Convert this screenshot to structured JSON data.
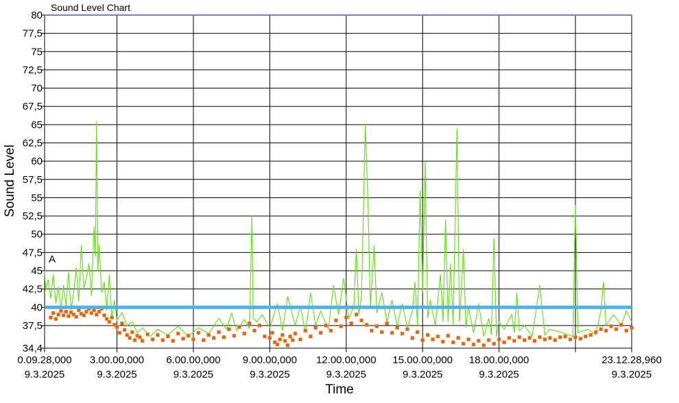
{
  "chart_data": {
    "type": "line",
    "title": "Sound Level Chart",
    "xlabel": "Time",
    "ylabel": "Sound Level",
    "ylim": [
      34.4,
      80
    ],
    "y_ticks": [
      "80",
      "77,5",
      "75",
      "72,5",
      "70",
      "67,5",
      "65",
      "62,5",
      "60",
      "57,5",
      "55",
      "52,5",
      "50",
      "47,5",
      "45",
      "42,5",
      "40",
      "37,5",
      "34,4"
    ],
    "x_range_hours": [
      0.158,
      23.208
    ],
    "x_ticks": [
      {
        "hour": 0.158,
        "time": "0.09.28,000",
        "date": "9.3.2025"
      },
      {
        "hour": 3,
        "time": "3.00.00,000",
        "date": "9.3.2025"
      },
      {
        "hour": 6,
        "time": "6.00.00,000",
        "date": "9.3.2025"
      },
      {
        "hour": 9,
        "time": "9.00.00,000",
        "date": "9.3.2025"
      },
      {
        "hour": 12,
        "time": "12.00.00,000",
        "date": "9.3.2025"
      },
      {
        "hour": 15,
        "time": "15.00.00,000",
        "date": "9.3.2025"
      },
      {
        "hour": 18,
        "time": "18.00.00,000",
        "date": "9.3.2025"
      },
      {
        "hour": 21,
        "time": "",
        "date": ""
      },
      {
        "hour": 23.208,
        "time": "23.12.28,960",
        "date": "9.3.2025"
      }
    ],
    "threshold": 40,
    "marker_label": "A",
    "colors": {
      "peak_line": "#66e01a",
      "level_markers": "#ee5a24",
      "level_marker_edge": "#c8b43c",
      "threshold": "#4fb3ea",
      "grid": "#000000",
      "top_border": "#6e7fd0"
    },
    "series": [
      {
        "style": "line",
        "points": [
          [
            0.158,
            45.0
          ],
          [
            0.2,
            42.3
          ],
          [
            0.3,
            43.8
          ],
          [
            0.4,
            41.2
          ],
          [
            0.5,
            44.5
          ],
          [
            0.6,
            40.5
          ],
          [
            0.7,
            42.8
          ],
          [
            0.8,
            39.8
          ],
          [
            0.9,
            43.0
          ],
          [
            1.0,
            40.2
          ],
          [
            1.1,
            44.8
          ],
          [
            1.2,
            39.6
          ],
          [
            1.3,
            42.0
          ],
          [
            1.4,
            45.5
          ],
          [
            1.5,
            40.8
          ],
          [
            1.6,
            48.5
          ],
          [
            1.7,
            42.5
          ],
          [
            1.8,
            44.0
          ],
          [
            1.9,
            46.0
          ],
          [
            2.0,
            41.5
          ],
          [
            2.1,
            51.0
          ],
          [
            2.15,
            47.0
          ],
          [
            2.2,
            65.5
          ],
          [
            2.25,
            45.0
          ],
          [
            2.3,
            48.5
          ],
          [
            2.4,
            42.0
          ],
          [
            2.5,
            43.5
          ],
          [
            2.6,
            39.5
          ],
          [
            2.7,
            44.5
          ],
          [
            2.8,
            38.5
          ],
          [
            2.9,
            41.0
          ],
          [
            3.0,
            38.2
          ],
          [
            3.2,
            39.3
          ],
          [
            3.4,
            37.5
          ],
          [
            3.6,
            38.0
          ],
          [
            3.8,
            36.5
          ],
          [
            4.0,
            37.2
          ],
          [
            4.3,
            36.0
          ],
          [
            4.6,
            37.0
          ],
          [
            5.0,
            36.2
          ],
          [
            5.4,
            37.4
          ],
          [
            5.8,
            36.0
          ],
          [
            6.2,
            37.2
          ],
          [
            6.6,
            36.4
          ],
          [
            7.0,
            38.5
          ],
          [
            7.3,
            37.0
          ],
          [
            7.5,
            39.2
          ],
          [
            7.7,
            36.8
          ],
          [
            8.0,
            38.3
          ],
          [
            8.2,
            37.1
          ],
          [
            8.3,
            52.5
          ],
          [
            8.35,
            38.5
          ],
          [
            8.5,
            38.0
          ],
          [
            8.7,
            39.0
          ],
          [
            9.0,
            37.2
          ],
          [
            9.3,
            40.5
          ],
          [
            9.5,
            36.8
          ],
          [
            9.7,
            41.5
          ],
          [
            10.0,
            37.5
          ],
          [
            10.2,
            40.2
          ],
          [
            10.4,
            36.5
          ],
          [
            10.6,
            42.0
          ],
          [
            10.8,
            37.5
          ],
          [
            11.0,
            39.5
          ],
          [
            11.3,
            37.0
          ],
          [
            11.5,
            43.0
          ],
          [
            11.7,
            39.0
          ],
          [
            11.9,
            44.0
          ],
          [
            12.1,
            38.5
          ],
          [
            12.3,
            40.0
          ],
          [
            12.4,
            48.0
          ],
          [
            12.5,
            39.0
          ],
          [
            12.6,
            41.5
          ],
          [
            12.75,
            65.0
          ],
          [
            12.85,
            55.0
          ],
          [
            12.95,
            40.0
          ],
          [
            13.1,
            48.5
          ],
          [
            13.2,
            39.2
          ],
          [
            13.4,
            42.0
          ],
          [
            13.6,
            38.0
          ],
          [
            13.8,
            41.0
          ],
          [
            14.0,
            37.5
          ],
          [
            14.2,
            40.5
          ],
          [
            14.4,
            37.2
          ],
          [
            14.6,
            39.5
          ],
          [
            14.7,
            43.5
          ],
          [
            14.8,
            37.5
          ],
          [
            14.9,
            56.0
          ],
          [
            15.0,
            42.0
          ],
          [
            15.1,
            60.0
          ],
          [
            15.2,
            38.5
          ],
          [
            15.3,
            41.0
          ],
          [
            15.5,
            37.5
          ],
          [
            15.7,
            44.5
          ],
          [
            15.8,
            38.0
          ],
          [
            15.9,
            52.0
          ],
          [
            16.0,
            38.0
          ],
          [
            16.1,
            46.0
          ],
          [
            16.2,
            37.5
          ],
          [
            16.35,
            64.5
          ],
          [
            16.45,
            38.0
          ],
          [
            16.6,
            48.0
          ],
          [
            16.7,
            37.2
          ],
          [
            16.8,
            40.0
          ],
          [
            17.0,
            36.5
          ],
          [
            17.2,
            40.5
          ],
          [
            17.4,
            36.0
          ],
          [
            17.6,
            38.5
          ],
          [
            17.7,
            36.2
          ],
          [
            17.8,
            49.5
          ],
          [
            17.9,
            36.0
          ],
          [
            18.0,
            38.0
          ],
          [
            18.2,
            37.0
          ],
          [
            18.5,
            39.0
          ],
          [
            18.6,
            36.5
          ],
          [
            18.7,
            42.0
          ],
          [
            18.8,
            36.8
          ],
          [
            19.0,
            37.5
          ],
          [
            19.3,
            36.0
          ],
          [
            19.6,
            43.0
          ],
          [
            19.8,
            36.2
          ],
          [
            20.0,
            37.0
          ],
          [
            20.5,
            36.5
          ],
          [
            20.9,
            36.0
          ],
          [
            21.0,
            54.0
          ],
          [
            21.1,
            36.5
          ],
          [
            21.5,
            37.0
          ],
          [
            21.8,
            36.2
          ],
          [
            22.0,
            39.5
          ],
          [
            22.1,
            43.5
          ],
          [
            22.2,
            37.5
          ],
          [
            22.5,
            39.0
          ],
          [
            22.8,
            37.5
          ],
          [
            23.0,
            39.5
          ],
          [
            23.208,
            38.0
          ]
        ]
      },
      {
        "style": "markers",
        "points": [
          [
            0.4,
            38.6
          ],
          [
            0.5,
            39.2
          ],
          [
            0.6,
            38.4
          ],
          [
            0.7,
            39.0
          ],
          [
            0.8,
            39.5
          ],
          [
            0.9,
            38.9
          ],
          [
            1.0,
            39.4
          ],
          [
            1.1,
            38.8
          ],
          [
            1.2,
            39.3
          ],
          [
            1.3,
            39.0
          ],
          [
            1.4,
            38.7
          ],
          [
            1.5,
            39.6
          ],
          [
            1.6,
            39.1
          ],
          [
            1.7,
            38.9
          ],
          [
            1.8,
            39.4
          ],
          [
            1.9,
            39.8
          ],
          [
            2.0,
            39.2
          ],
          [
            2.1,
            39.6
          ],
          [
            2.2,
            39.0
          ],
          [
            2.3,
            39.4
          ],
          [
            2.4,
            39.8
          ],
          [
            2.5,
            38.9
          ],
          [
            2.6,
            38.4
          ],
          [
            2.7,
            38.0
          ],
          [
            2.8,
            38.6
          ],
          [
            2.9,
            37.6
          ],
          [
            3.0,
            37.3
          ],
          [
            3.1,
            36.5
          ],
          [
            3.2,
            37.8
          ],
          [
            3.3,
            36.9
          ],
          [
            3.4,
            36.2
          ],
          [
            3.5,
            35.8
          ],
          [
            3.6,
            36.6
          ],
          [
            3.7,
            35.5
          ],
          [
            3.8,
            36.1
          ],
          [
            3.9,
            35.9
          ],
          [
            4.0,
            35.4
          ],
          [
            4.2,
            36.3
          ],
          [
            4.4,
            35.6
          ],
          [
            4.6,
            36.2
          ],
          [
            4.8,
            35.5
          ],
          [
            5.0,
            36.0
          ],
          [
            5.2,
            35.4
          ],
          [
            5.4,
            36.4
          ],
          [
            5.6,
            35.7
          ],
          [
            5.8,
            36.1
          ],
          [
            6.0,
            35.6
          ],
          [
            6.2,
            36.5
          ],
          [
            6.4,
            35.5
          ],
          [
            6.6,
            36.2
          ],
          [
            6.8,
            35.8
          ],
          [
            7.0,
            36.6
          ],
          [
            7.2,
            35.9
          ],
          [
            7.4,
            37.0
          ],
          [
            7.6,
            36.1
          ],
          [
            7.8,
            37.3
          ],
          [
            8.0,
            36.4
          ],
          [
            8.2,
            37.8
          ],
          [
            8.4,
            36.8
          ],
          [
            8.6,
            37.5
          ],
          [
            8.8,
            36.0
          ],
          [
            9.0,
            35.8
          ],
          [
            9.1,
            36.5
          ],
          [
            9.2,
            35.2
          ],
          [
            9.3,
            34.9
          ],
          [
            9.4,
            35.6
          ],
          [
            9.5,
            36.2
          ],
          [
            9.6,
            35.4
          ],
          [
            9.7,
            34.8
          ],
          [
            9.8,
            36.0
          ],
          [
            9.9,
            35.5
          ],
          [
            10.0,
            36.4
          ],
          [
            10.2,
            35.6
          ],
          [
            10.4,
            36.8
          ],
          [
            10.6,
            36.0
          ],
          [
            10.8,
            37.2
          ],
          [
            11.0,
            36.5
          ],
          [
            11.2,
            37.5
          ],
          [
            11.4,
            36.8
          ],
          [
            11.6,
            38.2
          ],
          [
            11.8,
            37.4
          ],
          [
            12.0,
            38.6
          ],
          [
            12.2,
            37.8
          ],
          [
            12.4,
            39.0
          ],
          [
            12.6,
            38.2
          ],
          [
            12.8,
            37.6
          ],
          [
            13.0,
            36.8
          ],
          [
            13.2,
            37.4
          ],
          [
            13.4,
            36.6
          ],
          [
            13.6,
            37.8
          ],
          [
            13.8,
            36.5
          ],
          [
            14.0,
            37.2
          ],
          [
            14.2,
            36.4
          ],
          [
            14.4,
            37.0
          ],
          [
            14.6,
            35.8
          ],
          [
            14.8,
            36.6
          ],
          [
            15.0,
            35.5
          ],
          [
            15.2,
            36.2
          ],
          [
            15.4,
            35.6
          ],
          [
            15.6,
            36.0
          ],
          [
            15.8,
            35.3
          ],
          [
            16.0,
            36.1
          ],
          [
            16.2,
            35.2
          ],
          [
            16.4,
            35.8
          ],
          [
            16.6,
            35.0
          ],
          [
            16.8,
            35.6
          ],
          [
            17.0,
            34.9
          ],
          [
            17.2,
            35.4
          ],
          [
            17.4,
            34.8
          ],
          [
            17.6,
            35.5
          ],
          [
            17.8,
            35.0
          ],
          [
            18.0,
            35.6
          ],
          [
            18.2,
            35.2
          ],
          [
            18.4,
            35.8
          ],
          [
            18.6,
            35.4
          ],
          [
            18.8,
            35.9
          ],
          [
            19.0,
            35.5
          ],
          [
            19.2,
            35.8
          ],
          [
            19.4,
            35.4
          ],
          [
            19.6,
            35.9
          ],
          [
            19.8,
            35.6
          ],
          [
            20.0,
            35.8
          ],
          [
            20.2,
            35.5
          ],
          [
            20.4,
            35.9
          ],
          [
            20.6,
            36.0
          ],
          [
            20.8,
            35.6
          ],
          [
            21.0,
            35.9
          ],
          [
            21.2,
            35.7
          ],
          [
            21.4,
            36.0
          ],
          [
            21.6,
            36.2
          ],
          [
            21.8,
            36.6
          ],
          [
            22.0,
            37.0
          ],
          [
            22.2,
            36.8
          ],
          [
            22.4,
            37.4
          ],
          [
            22.6,
            37.0
          ],
          [
            22.8,
            37.6
          ],
          [
            23.0,
            36.8
          ],
          [
            23.208,
            37.2
          ]
        ]
      }
    ]
  }
}
